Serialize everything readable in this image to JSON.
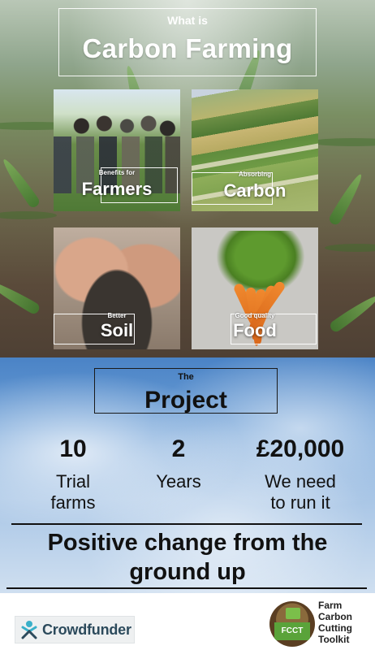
{
  "header": {
    "subtitle": "What is",
    "title": "Carbon Farming"
  },
  "tiles": [
    {
      "small": "Benefits for",
      "big": "Farmers"
    },
    {
      "small": "Absorbing",
      "big": "Carbon"
    },
    {
      "small": "Better",
      "big": "Soil"
    },
    {
      "small": "Good quality",
      "big": "Food"
    }
  ],
  "project": {
    "small": "The",
    "title": "Project"
  },
  "stats": [
    {
      "number": "10",
      "label_line1": "Trial",
      "label_line2": "farms"
    },
    {
      "number": "2",
      "label_line1": "Years",
      "label_line2": ""
    },
    {
      "number": "£20,000",
      "label_line1": "We need",
      "label_line2": "to run it"
    }
  ],
  "tagline": {
    "line1": "Positive change from the",
    "line2": "ground up"
  },
  "footer": {
    "crowdfunder": "Crowdfunder",
    "fcct_badge": "FCCT",
    "fcct_line1": "Farm",
    "fcct_line2": "Carbon",
    "fcct_line3": "Cutting",
    "fcct_line4": "Toolkit"
  },
  "colors": {
    "crowdfunder_brand": "#2c4a5c",
    "crowdfunder_mark": "#3ab0c9",
    "fcct_green": "#5aa33a"
  }
}
